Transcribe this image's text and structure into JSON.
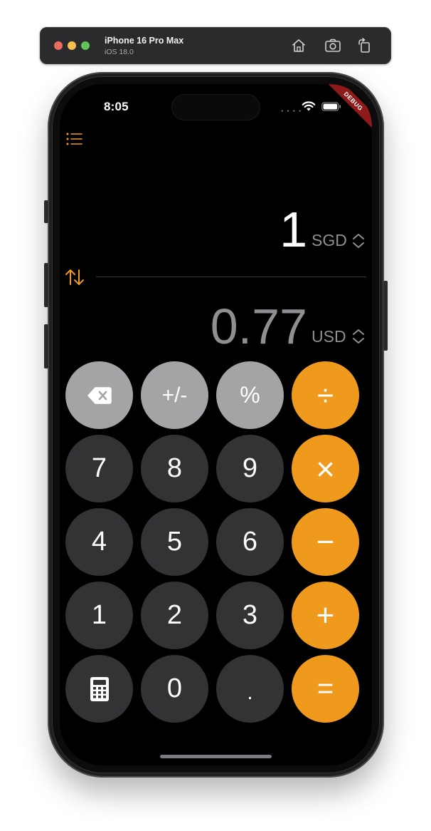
{
  "simulator": {
    "device_name": "iPhone 16 Pro Max",
    "os_version": "iOS 18.0"
  },
  "status_bar": {
    "time": "8:05",
    "debug_banner": "DEBUG"
  },
  "converter": {
    "from_amount": "1",
    "from_currency": "SGD",
    "to_amount": "0.77",
    "to_currency": "USD"
  },
  "keypad": {
    "backspace": "backspace-icon",
    "plus_minus": "+/-",
    "percent": "%",
    "divide": "÷",
    "seven": "7",
    "eight": "8",
    "nine": "9",
    "multiply": "×",
    "four": "4",
    "five": "5",
    "six": "6",
    "minus": "−",
    "one": "1",
    "two": "2",
    "three": "3",
    "plus": "+",
    "calculator": "calculator-icon",
    "zero": "0",
    "decimal": ".",
    "equals": "="
  },
  "colors": {
    "accent": "#f09a1d",
    "key_dark": "#333335",
    "key_light": "#a4a4a6",
    "secondary_text": "#8e8e93"
  }
}
